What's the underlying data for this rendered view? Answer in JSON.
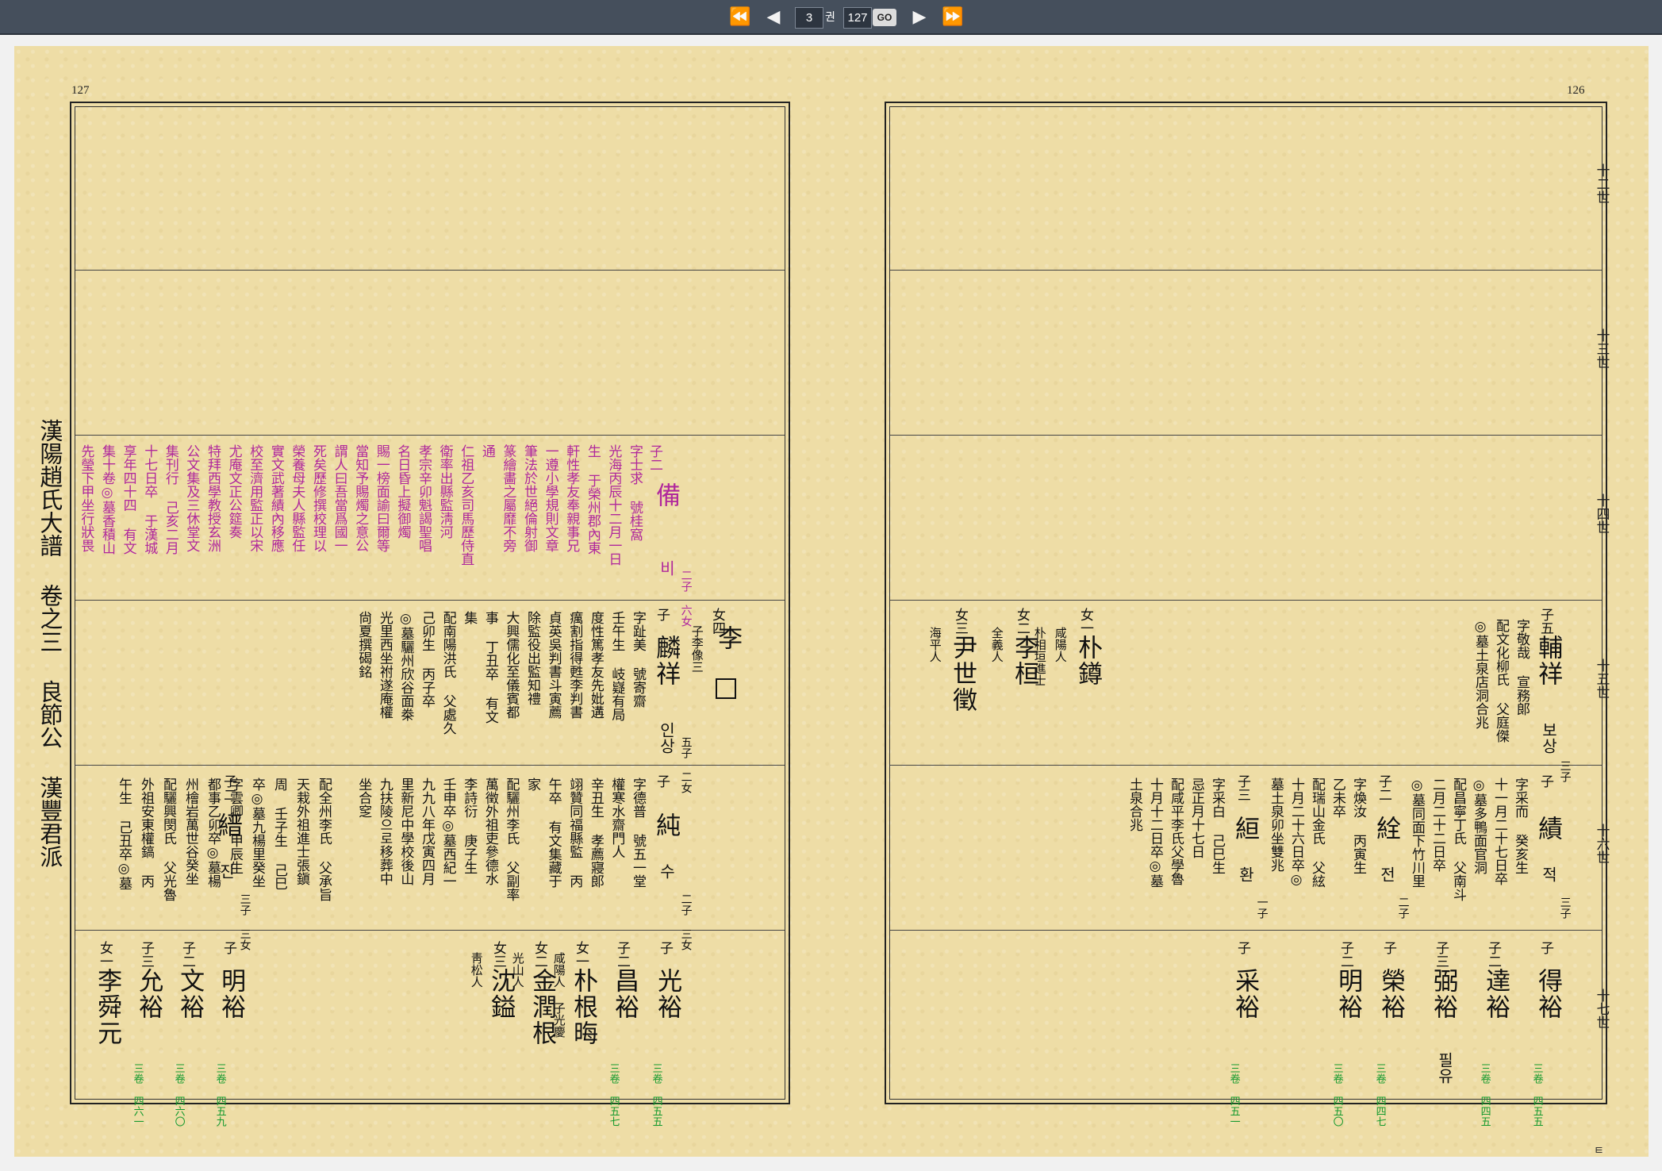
{
  "nav": {
    "first_label": "⏪",
    "prev_label": "◀",
    "vol_value": "3",
    "vol_unit": "권",
    "page_value": "127",
    "go_label": "GO",
    "next_label": "▶",
    "last_label": "⏩"
  },
  "book": {
    "page_left": "127",
    "page_right": "126",
    "spine": "漢陽趙氏大譜 卷之三 良節公 漢豐君派",
    "generations": [
      "十二世",
      "十三世",
      "十四世",
      "十五世",
      "十六世",
      "十七世"
    ]
  },
  "left": {
    "r14": {
      "rel": "子二",
      "name": "備",
      "ko": "비",
      "kids": "二子 六女",
      "lines": [
        "字士求 號桂窩",
        "光海丙辰十二月一日",
        "生 于榮州郡內東",
        "軒性孝友奉親事兄",
        "一遵小學規則文章",
        "筆法於世絕倫射御",
        "篆繪畵之屬靡不旁",
        "通",
        "仁祖乙亥司馬歷侍直",
        "衛率出縣監淸河",
        "孝宗辛卯魁謁聖唱",
        "名日昏上擬御燭",
        "賜一榜面諭曰爾等",
        "當知予賜燭之意公",
        "謂人曰吾當爲國一",
        "死矣歷修撰校理以",
        "榮養母夫人縣監任",
        "實文武著績內移應",
        "校至濟用監正以宋",
        "尤庵文正公筵奏",
        "特拜西學教授玄洲",
        "公文集及三休堂文",
        "集刊行 己亥二月",
        "十七日卒 于漢城",
        "享年四十四 有文",
        "集十卷◎墓香積山",
        "先瑩下甲坐行狀畏"
      ]
    },
    "r15": {
      "rel_a": "女四",
      "name_a": "李",
      "sub_a": "子李像三",
      "rel_b": "子",
      "name_b": "麟祥",
      "ko": "인상",
      "kids": "五子 二女",
      "lines": [
        "字趾美 號寄齋",
        "壬午生 岐嶷有局",
        "度性篤孝友先妣遘",
        "癘割指得甦李判書",
        "貞英吳判書斗寅薦",
        "除監役出監知禮",
        "大興儒化至儀賓都",
        "事 丁丑卒 有文",
        "集",
        "配南陽洪氏 父處久",
        "己卯生 丙子卒",
        "◎墓驪州欣谷面桊",
        "光里西坐祔遂庵權",
        "尙夏撰碣銘"
      ]
    },
    "r16a": {
      "rel": "子",
      "name": "純",
      "ko": "수",
      "kids": "二子 三女",
      "lines": [
        "字德普 號五一堂",
        "權寒水齋門人",
        "辛丑生 孝薦寢郞",
        "翊贊同福縣監 丙",
        "午卒 有文集藏于",
        "家",
        "配驪州李氏 父副率",
        "萬徵外祖吏參德水",
        "李詩衍 庚子生",
        "壬申卒◎墓西紀一",
        "九九八年戊寅四月",
        "里新尼中學校後山",
        "九扶陵으로移葬中",
        "坐合窆"
      ]
    },
    "r16b": {
      "rel": "子二",
      "name": "縉",
      "ko": "진",
      "kids": "三子 三女",
      "lines": [
        "配全州李氏 父承旨",
        "天栽外祖進士張鎭",
        "周 壬子生 己巳",
        "卒◎墓九楊里癸坐",
        "字雲卿 甲辰生",
        "都事乙卯卒◎墓楊",
        "州檜岩萬世谷癸坐",
        "配驪興閔氏 父光魯",
        "外祖安東權鎬 丙",
        "午生 己丑卒◎墓"
      ]
    },
    "r17": [
      {
        "rel": "子",
        "name": "光裕",
        "tag": "三卷 四五五"
      },
      {
        "rel": "子二",
        "name": "昌裕",
        "tag": "三卷 四五七"
      },
      {
        "rel": "女一",
        "name": "朴根晦",
        "note": "咸陽人 子光慶"
      },
      {
        "rel": "女二",
        "name": "金潤根",
        "note": "光山人"
      },
      {
        "rel": "女三",
        "name": "沈鎰",
        "note": "靑松人"
      },
      {
        "rel": "子",
        "name": "明裕",
        "tag": "三卷 四五九"
      },
      {
        "rel": "子二",
        "name": "文裕",
        "tag": "三卷 四六〇"
      },
      {
        "rel": "子三",
        "name": "允裕",
        "tag": "三卷 四六一"
      },
      {
        "rel": "女一",
        "name": "李舜元"
      }
    ]
  },
  "right": {
    "r15": [
      {
        "rel": "子五",
        "name": "輔祥",
        "ko": "보상",
        "kids": "三子",
        "lines": [
          "字敬哉 宣務郞",
          "配文化柳氏 父庭傑",
          "◎墓土泉店洞合兆"
        ]
      },
      {
        "rel": "女一",
        "name": "朴鐏",
        "lines": [
          "咸陽人",
          "朴相垣進士"
        ]
      },
      {
        "rel": "女二",
        "name": "李桓",
        "lines": [
          "全義人"
        ]
      },
      {
        "rel": "女三",
        "name": "尹世徵",
        "lines": [
          "海平人"
        ]
      }
    ],
    "r16": [
      {
        "rel": "子",
        "name": "績",
        "ko": "적",
        "kids": "三子",
        "lines": [
          "字采而 癸亥生",
          "十一月二十七日卒",
          "◎墓多鴨面官洞",
          "配昌寧丁氏 父南斗",
          "二月二十二日卒",
          "◎墓同面下竹川里"
        ]
      },
      {
        "rel": "子二",
        "name": "絟",
        "ko": "전",
        "kids": "二子",
        "lines": [
          "字煥汝 丙寅生",
          "乙未卒",
          "配瑞山金氏 父絃",
          "十月二十六日卒◎",
          "墓土泉卯坐雙兆"
        ]
      },
      {
        "rel": "子三",
        "name": "絙",
        "ko": "환",
        "kids": "一子",
        "lines": [
          "字采白 己巳生",
          "忌正月十七日",
          "配咸平李氏父學魯",
          "十月十二日卒◎墓",
          "土泉合兆"
        ]
      }
    ],
    "r17": [
      {
        "rel": "子",
        "name": "得裕",
        "tag": "三卷 四五五"
      },
      {
        "rel": "子二",
        "name": "達裕",
        "tag": "三卷 四四五"
      },
      {
        "rel": "子三",
        "name": "弼裕",
        "ko": "필유"
      },
      {
        "rel": "子",
        "name": "榮裕",
        "tag": "三卷 四四七"
      },
      {
        "rel": "子二",
        "name": "明裕",
        "tag": "三卷 四五〇"
      },
      {
        "rel": "子",
        "name": "采裕",
        "tag": "三卷 四五一"
      }
    ]
  }
}
